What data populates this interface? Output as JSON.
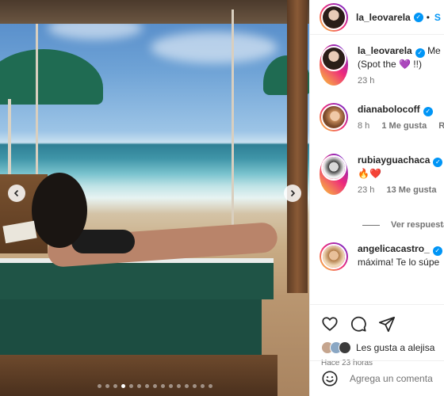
{
  "post": {
    "author": "la_leovarela",
    "follow_label": "S",
    "caption": "Me",
    "caption_line2": "(Spot the 💜 !!)",
    "caption_time": "23 h",
    "carousel_dots": 15,
    "carousel_active_index": 3
  },
  "comments": [
    {
      "user": "dianabolocoff",
      "text": "",
      "time": "8 h",
      "likes": "1 Me gusta",
      "reply": "Re"
    },
    {
      "user": "rubiayguachaca",
      "text": "🔥❤️",
      "time": "23 h",
      "likes": "13 Me gusta",
      "reply": ""
    },
    {
      "user": "angelicacastro_",
      "text": "máxima! Te lo súpe",
      "time": "",
      "likes": "",
      "reply": ""
    }
  ],
  "view_replies_label": "Ver respuesta",
  "actions": {
    "liked_by_text": "Les gusta a alejisa",
    "post_time": "Hace 23 horas",
    "add_comment_placeholder": "Agrega un comenta"
  },
  "icons": {
    "like": "heart-icon",
    "comment": "comment-icon",
    "share": "share-icon",
    "emoji": "emoji-icon",
    "prev": "chevron-left-icon",
    "next": "chevron-right-icon"
  },
  "colors": {
    "accent": "#0095f6",
    "text": "#262626",
    "muted": "#737373"
  }
}
